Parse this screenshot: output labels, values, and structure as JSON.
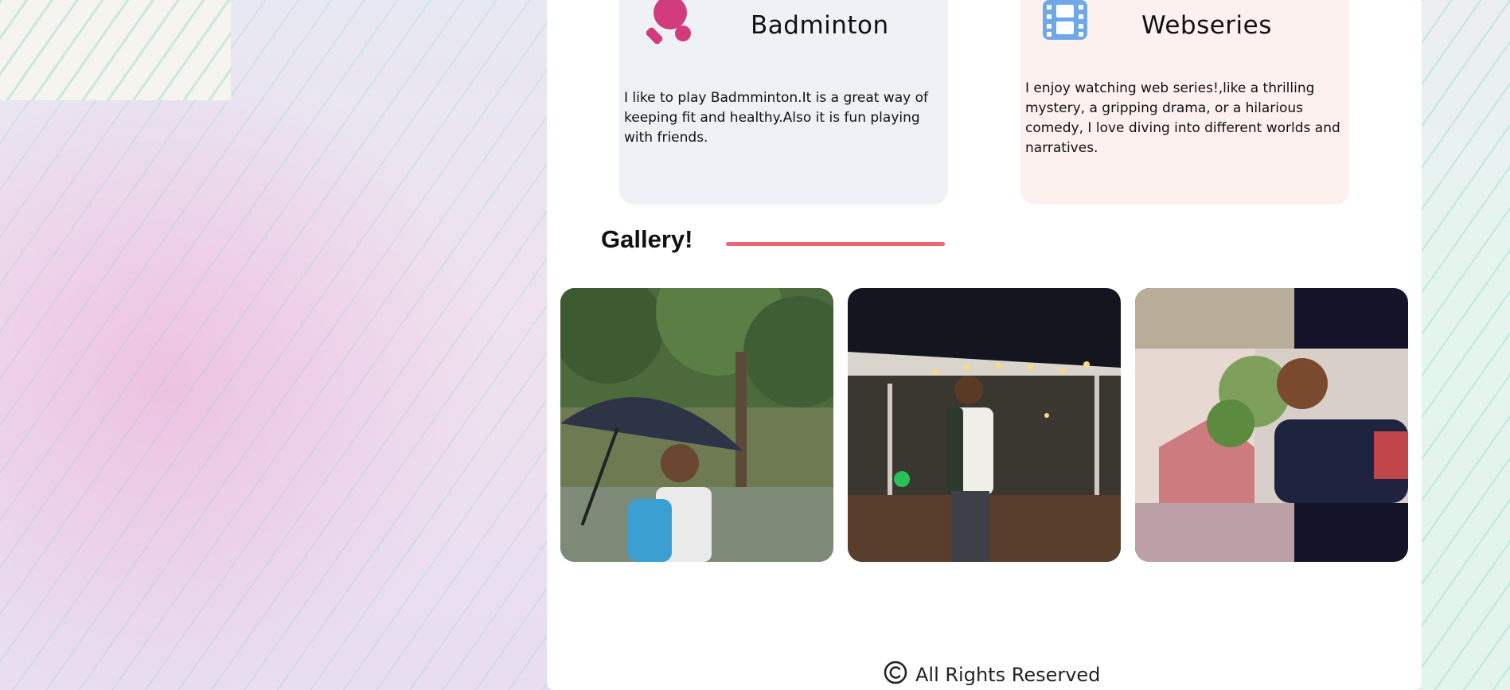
{
  "hobbies": {
    "badminton": {
      "title": "Badminton",
      "text": "I like to play Badmminton.It is a great way of keeping fit and healthy.Also it is fun playing with friends.",
      "icon": "ping-pong-paddle-icon",
      "icon_color": "#d23c7e"
    },
    "webseries": {
      "title": "Webseries",
      "text": "I enjoy watching web series!,like a thrilling mystery, a gripping drama, or a hilarious comedy, I love diving into different worlds and narratives.",
      "icon": "film-strip-icon",
      "icon_color": "#6fa8e6"
    }
  },
  "gallery": {
    "title": "Gallery!",
    "accent_color": "#ec6674",
    "photos": [
      {
        "name": "photo-umbrella"
      },
      {
        "name": "photo-restaurant"
      },
      {
        "name": "photo-selfie"
      }
    ]
  },
  "footer": {
    "icon": "copyright-icon",
    "text": "All Rights Reserved"
  }
}
